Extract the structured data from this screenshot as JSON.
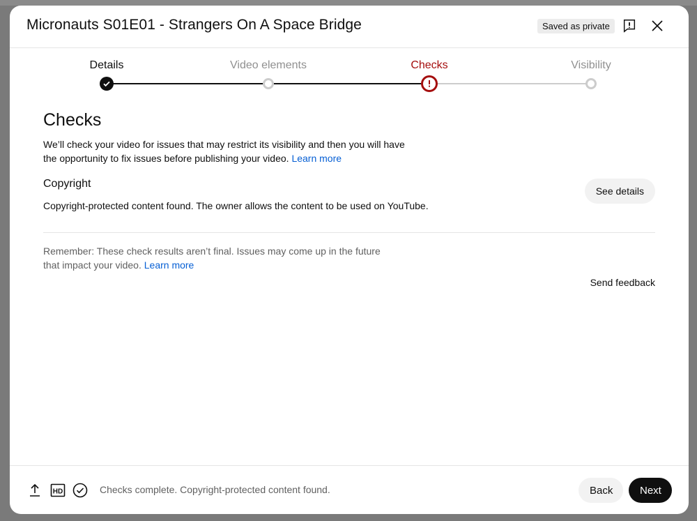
{
  "dialog": {
    "title": "Micronauts S01E01 - Strangers On A Space Bridge",
    "saved_badge": "Saved as private"
  },
  "stepper": {
    "steps": [
      {
        "label": "Details",
        "state": "done"
      },
      {
        "label": "Video elements",
        "state": "pending"
      },
      {
        "label": "Checks",
        "state": "active"
      },
      {
        "label": "Visibility",
        "state": "pending"
      }
    ]
  },
  "checks": {
    "heading": "Checks",
    "intro": "We’ll check your video for issues that may restrict its visibility and then you will have the opportunity to fix issues before publishing your video.",
    "intro_link": "Learn more",
    "copyright": {
      "heading": "Copyright",
      "text": "Copyright-protected content found. The owner allows the content to be used on YouTube.",
      "button": "See details"
    },
    "remember": "Remember: These check results aren’t final. Issues may come up in the future that impact your video.",
    "remember_link": "Learn more",
    "send_feedback": "Send feedback"
  },
  "footer": {
    "icons": [
      "upload-icon",
      "hd-icon",
      "check-circle-icon"
    ],
    "status": "Checks complete. Copyright-protected content found.",
    "back_label": "Back",
    "next_label": "Next"
  },
  "colors": {
    "active_step": "#a50e0e",
    "link": "#065fd4",
    "primary_button": "#0f0f0f",
    "secondary_button": "#f2f2f2"
  }
}
